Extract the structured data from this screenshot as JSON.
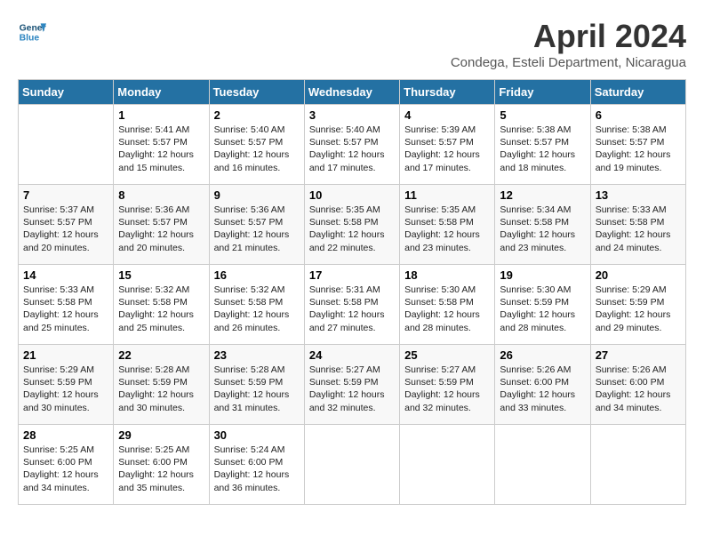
{
  "header": {
    "logo_line1": "General",
    "logo_line2": "Blue",
    "title": "April 2024",
    "subtitle": "Condega, Esteli Department, Nicaragua"
  },
  "calendar": {
    "days_of_week": [
      "Sunday",
      "Monday",
      "Tuesday",
      "Wednesday",
      "Thursday",
      "Friday",
      "Saturday"
    ],
    "weeks": [
      [
        {
          "day": "",
          "info": ""
        },
        {
          "day": "1",
          "info": "Sunrise: 5:41 AM\nSunset: 5:57 PM\nDaylight: 12 hours\nand 15 minutes."
        },
        {
          "day": "2",
          "info": "Sunrise: 5:40 AM\nSunset: 5:57 PM\nDaylight: 12 hours\nand 16 minutes."
        },
        {
          "day": "3",
          "info": "Sunrise: 5:40 AM\nSunset: 5:57 PM\nDaylight: 12 hours\nand 17 minutes."
        },
        {
          "day": "4",
          "info": "Sunrise: 5:39 AM\nSunset: 5:57 PM\nDaylight: 12 hours\nand 17 minutes."
        },
        {
          "day": "5",
          "info": "Sunrise: 5:38 AM\nSunset: 5:57 PM\nDaylight: 12 hours\nand 18 minutes."
        },
        {
          "day": "6",
          "info": "Sunrise: 5:38 AM\nSunset: 5:57 PM\nDaylight: 12 hours\nand 19 minutes."
        }
      ],
      [
        {
          "day": "7",
          "info": "Sunrise: 5:37 AM\nSunset: 5:57 PM\nDaylight: 12 hours\nand 20 minutes."
        },
        {
          "day": "8",
          "info": "Sunrise: 5:36 AM\nSunset: 5:57 PM\nDaylight: 12 hours\nand 20 minutes."
        },
        {
          "day": "9",
          "info": "Sunrise: 5:36 AM\nSunset: 5:57 PM\nDaylight: 12 hours\nand 21 minutes."
        },
        {
          "day": "10",
          "info": "Sunrise: 5:35 AM\nSunset: 5:58 PM\nDaylight: 12 hours\nand 22 minutes."
        },
        {
          "day": "11",
          "info": "Sunrise: 5:35 AM\nSunset: 5:58 PM\nDaylight: 12 hours\nand 23 minutes."
        },
        {
          "day": "12",
          "info": "Sunrise: 5:34 AM\nSunset: 5:58 PM\nDaylight: 12 hours\nand 23 minutes."
        },
        {
          "day": "13",
          "info": "Sunrise: 5:33 AM\nSunset: 5:58 PM\nDaylight: 12 hours\nand 24 minutes."
        }
      ],
      [
        {
          "day": "14",
          "info": "Sunrise: 5:33 AM\nSunset: 5:58 PM\nDaylight: 12 hours\nand 25 minutes."
        },
        {
          "day": "15",
          "info": "Sunrise: 5:32 AM\nSunset: 5:58 PM\nDaylight: 12 hours\nand 25 minutes."
        },
        {
          "day": "16",
          "info": "Sunrise: 5:32 AM\nSunset: 5:58 PM\nDaylight: 12 hours\nand 26 minutes."
        },
        {
          "day": "17",
          "info": "Sunrise: 5:31 AM\nSunset: 5:58 PM\nDaylight: 12 hours\nand 27 minutes."
        },
        {
          "day": "18",
          "info": "Sunrise: 5:30 AM\nSunset: 5:58 PM\nDaylight: 12 hours\nand 28 minutes."
        },
        {
          "day": "19",
          "info": "Sunrise: 5:30 AM\nSunset: 5:59 PM\nDaylight: 12 hours\nand 28 minutes."
        },
        {
          "day": "20",
          "info": "Sunrise: 5:29 AM\nSunset: 5:59 PM\nDaylight: 12 hours\nand 29 minutes."
        }
      ],
      [
        {
          "day": "21",
          "info": "Sunrise: 5:29 AM\nSunset: 5:59 PM\nDaylight: 12 hours\nand 30 minutes."
        },
        {
          "day": "22",
          "info": "Sunrise: 5:28 AM\nSunset: 5:59 PM\nDaylight: 12 hours\nand 30 minutes."
        },
        {
          "day": "23",
          "info": "Sunrise: 5:28 AM\nSunset: 5:59 PM\nDaylight: 12 hours\nand 31 minutes."
        },
        {
          "day": "24",
          "info": "Sunrise: 5:27 AM\nSunset: 5:59 PM\nDaylight: 12 hours\nand 32 minutes."
        },
        {
          "day": "25",
          "info": "Sunrise: 5:27 AM\nSunset: 5:59 PM\nDaylight: 12 hours\nand 32 minutes."
        },
        {
          "day": "26",
          "info": "Sunrise: 5:26 AM\nSunset: 6:00 PM\nDaylight: 12 hours\nand 33 minutes."
        },
        {
          "day": "27",
          "info": "Sunrise: 5:26 AM\nSunset: 6:00 PM\nDaylight: 12 hours\nand 34 minutes."
        }
      ],
      [
        {
          "day": "28",
          "info": "Sunrise: 5:25 AM\nSunset: 6:00 PM\nDaylight: 12 hours\nand 34 minutes."
        },
        {
          "day": "29",
          "info": "Sunrise: 5:25 AM\nSunset: 6:00 PM\nDaylight: 12 hours\nand 35 minutes."
        },
        {
          "day": "30",
          "info": "Sunrise: 5:24 AM\nSunset: 6:00 PM\nDaylight: 12 hours\nand 36 minutes."
        },
        {
          "day": "",
          "info": ""
        },
        {
          "day": "",
          "info": ""
        },
        {
          "day": "",
          "info": ""
        },
        {
          "day": "",
          "info": ""
        }
      ]
    ]
  }
}
